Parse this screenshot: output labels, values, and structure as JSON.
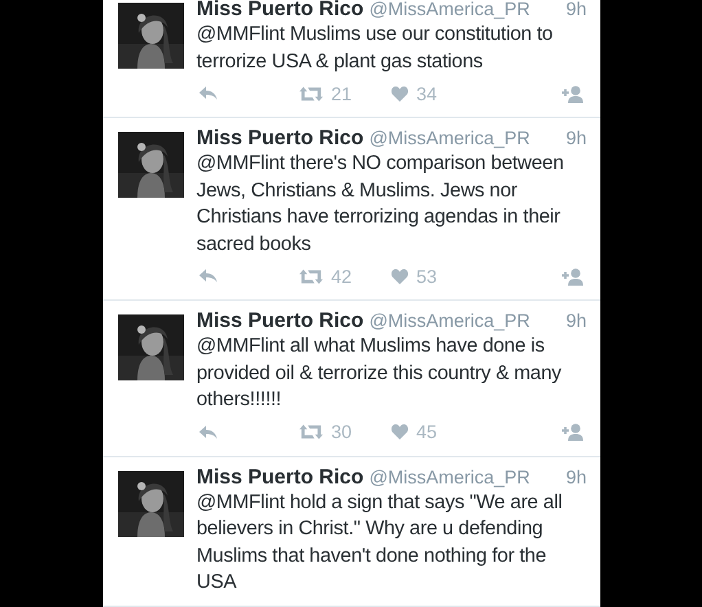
{
  "tweets": [
    {
      "name": "Miss Puerto Rico",
      "handle": "@MissAmerica_PR",
      "time": "9h",
      "text": "@MMFlint Muslims use our constitution to terrorize USA & plant gas stations",
      "actions": {
        "retweets": "21",
        "likes": "34"
      }
    },
    {
      "name": "Miss Puerto Rico",
      "handle": "@MissAmerica_PR",
      "time": "9h",
      "text": "@MMFlint there's NO comparison between Jews, Christians & Muslims. Jews nor Christians have terrorizing agendas in their sacred books",
      "actions": {
        "retweets": "42",
        "likes": "53"
      }
    },
    {
      "name": "Miss Puerto Rico",
      "handle": "@MissAmerica_PR",
      "time": "9h",
      "text": "@MMFlint all what Muslims have done is provided oil & terrorize this country & many others!!!!!!",
      "actions": {
        "retweets": "30",
        "likes": "45"
      }
    },
    {
      "name": "Miss Puerto Rico",
      "handle": "@MissAmerica_PR",
      "time": "9h",
      "text": "@MMFlint hold a sign that says \"We are all believers in Christ.\" Why are u defending Muslims that haven't done nothing for the USA"
    }
  ]
}
